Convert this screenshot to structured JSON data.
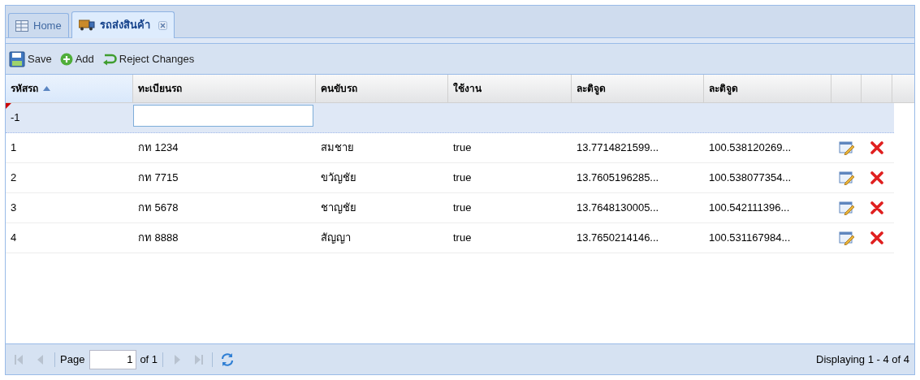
{
  "tabs": [
    {
      "label": "Home",
      "selected": false,
      "closable": false,
      "kind": "grid"
    },
    {
      "label": "รถส่งสินค้า",
      "selected": true,
      "closable": true,
      "kind": "truck"
    }
  ],
  "toolbar": [
    {
      "label": "Save",
      "kind": "save"
    },
    {
      "label": "Add",
      "kind": "add"
    },
    {
      "label": "Reject Changes",
      "kind": "undo"
    }
  ],
  "table": {
    "columns": [
      {
        "label": "รหัสรถ",
        "sorted": true
      },
      {
        "label": "ทะเบียนรถ",
        "sorted": false
      },
      {
        "label": "คนขับรถ",
        "sorted": false
      },
      {
        "label": "ใช้งาน",
        "sorted": false
      },
      {
        "label": "ละติจูด",
        "sorted": false
      },
      {
        "label": "ละติจูด",
        "sorted": false
      }
    ],
    "rows": [
      {
        "cells": [
          "-1"
        ],
        "selected": true,
        "dirty": true,
        "editing": true,
        "actions": false
      },
      {
        "cells": [
          "1",
          "กท 1234",
          "สมชาย",
          "true",
          "13.7714821599...",
          "100.538120269..."
        ],
        "selected": false,
        "dirty": false,
        "editing": false,
        "actions": true
      },
      {
        "cells": [
          "2",
          "กท 7715",
          "ขวัญชัย",
          "true",
          "13.7605196285...",
          "100.538077354..."
        ],
        "selected": false,
        "dirty": false,
        "editing": false,
        "actions": true
      },
      {
        "cells": [
          "3",
          "กท 5678",
          "ชาญชัย",
          "true",
          "13.7648130005...",
          "100.542111396..."
        ],
        "selected": false,
        "dirty": false,
        "editing": false,
        "actions": true
      },
      {
        "cells": [
          "4",
          "กท 8888",
          "สัญญา",
          "true",
          "13.7650214146...",
          "100.531167984..."
        ],
        "selected": false,
        "dirty": false,
        "editing": false,
        "actions": true
      }
    ]
  },
  "paging": {
    "first_disabled": true,
    "prev_disabled": true,
    "next_disabled": true,
    "last_disabled": true,
    "page_label": "Page",
    "page_value": "1",
    "of_label": "of 1",
    "display": "Displaying 1 - 4 of 4"
  }
}
